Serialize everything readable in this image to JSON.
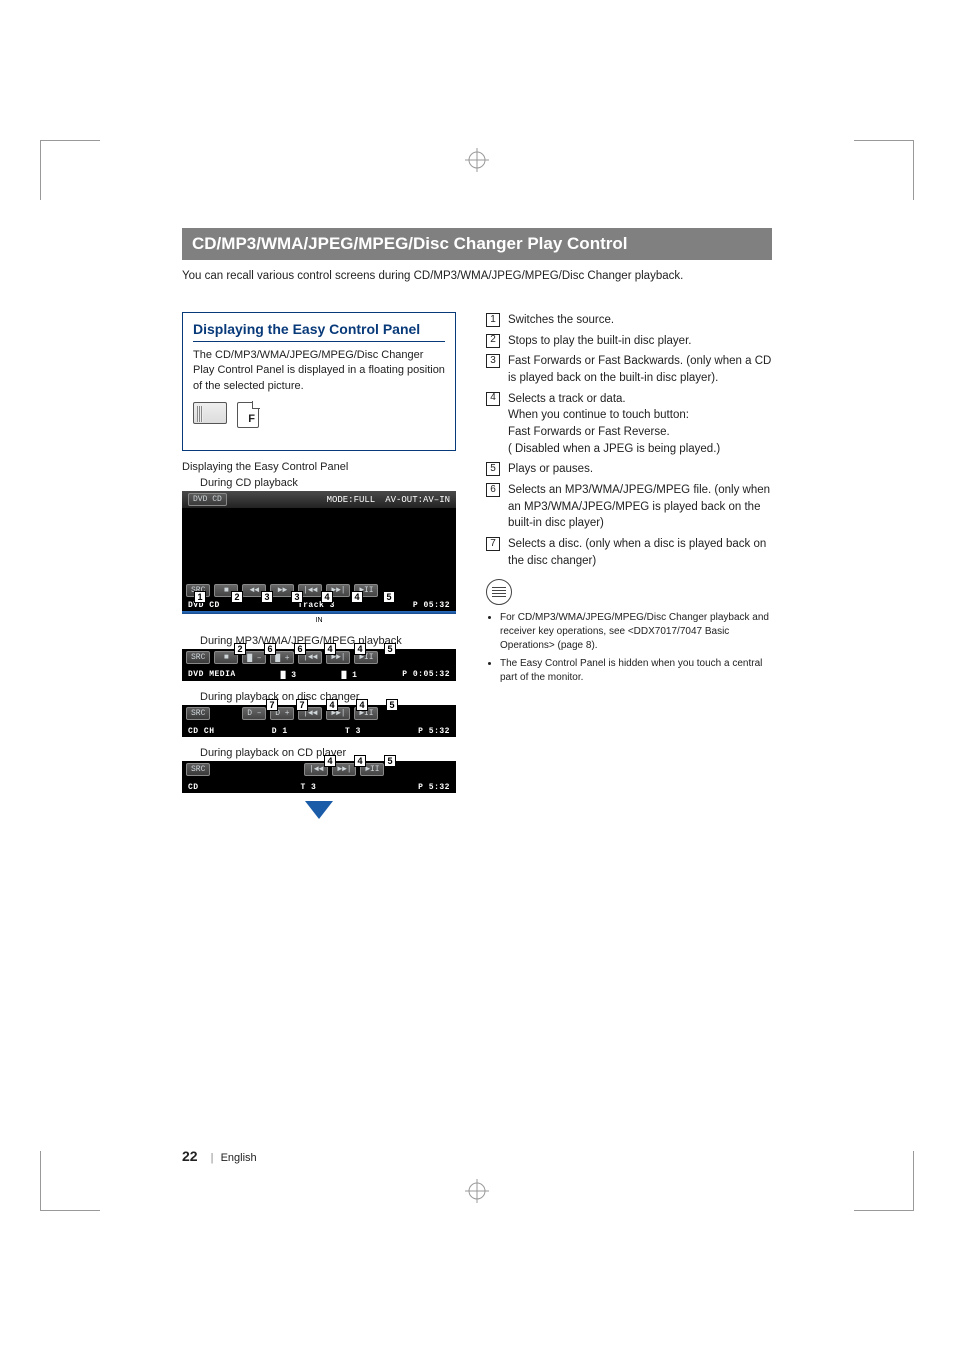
{
  "header": {
    "title": "CD/MP3/WMA/JPEG/MPEG/Disc Changer Play Control",
    "intro": "You can recall various control screens during CD/MP3/WMA/JPEG/MPEG/Disc Changer playback."
  },
  "easy_panel_box": {
    "title": "Displaying the Easy Control Panel",
    "desc": "The CD/MP3/WMA/JPEG/MPEG/Disc Changer Play Control Panel is displayed in a floating position of the selected picture."
  },
  "icon_f_label": "F",
  "captions": {
    "cd": "Displaying the Easy Control Panel",
    "cd_sub": "During CD playback",
    "mp3": "During MP3/WMA/JPEG/MPEG playback",
    "disc_changer": "During playback on disc changer",
    "cd_player": "During playback on CD player"
  },
  "panel_top": {
    "source_label": "DVD CD",
    "mode": "MODE:FULL",
    "avout": "AV-OUT:AV–IN"
  },
  "panel_big_status": {
    "left": "DVD CD",
    "center": "Track 3",
    "right": "P 05:32",
    "in": "IN"
  },
  "btn_src": "SRC",
  "glyphs": {
    "stop": "■",
    "rew": "◄◄",
    "fwd": "►►",
    "prev": "|◄◄",
    "next": "►►|",
    "playpause": "►II",
    "folder_dn": "▇ –",
    "folder_up": "▇ +",
    "disc_dn": "D –",
    "disc_up": "D +"
  },
  "panel_mp3_status": {
    "left": "DVD MEDIA",
    "c1": "▇ 3",
    "c2": "▇ 1",
    "right": "P 0:05:32"
  },
  "panel_dc_status": {
    "left": "CD CH",
    "c1": "D 1",
    "c2": "T 3",
    "right": "P 5:32"
  },
  "panel_cd_status": {
    "left": "CD",
    "center": "T 3",
    "right": "P 5:32"
  },
  "callouts_big": [
    "1",
    "2",
    "3",
    "3",
    "4",
    "4",
    "5"
  ],
  "callouts_mp3": [
    "2",
    "6",
    "6",
    "4",
    "4",
    "5"
  ],
  "callouts_dc": [
    "7",
    "7",
    "4",
    "4",
    "5"
  ],
  "callouts_cd": [
    "4",
    "4",
    "5"
  ],
  "definitions": [
    {
      "n": "1",
      "text": "Switches the source."
    },
    {
      "n": "2",
      "text": "Stops to play the built-in disc player."
    },
    {
      "n": "3",
      "text": "Fast Forwards or Fast Backwards. (only when a CD is played back on the built-in disc player)."
    },
    {
      "n": "4",
      "text": "Selects a track or data.\nWhen you continue to touch button:\nFast Forwards or Fast Reverse.\n( Disabled when a JPEG is being played.)"
    },
    {
      "n": "5",
      "text": "Plays or pauses."
    },
    {
      "n": "6",
      "text": "Selects an MP3/WMA/JPEG/MPEG file. (only when an MP3/WMA/JPEG/MPEG is played back on the built-in disc player)"
    },
    {
      "n": "7",
      "text": "Selects a disc. (only when a disc is played back on the disc changer)"
    }
  ],
  "notes": [
    "For CD/MP3/WMA/JPEG/MPEG/Disc Changer playback and receiver key operations, see <DDX7017/7047 Basic Operations> (page 8).",
    "The Easy Control Panel is hidden when you touch a central part of the monitor."
  ],
  "footer": {
    "page": "22",
    "lang": "English"
  }
}
